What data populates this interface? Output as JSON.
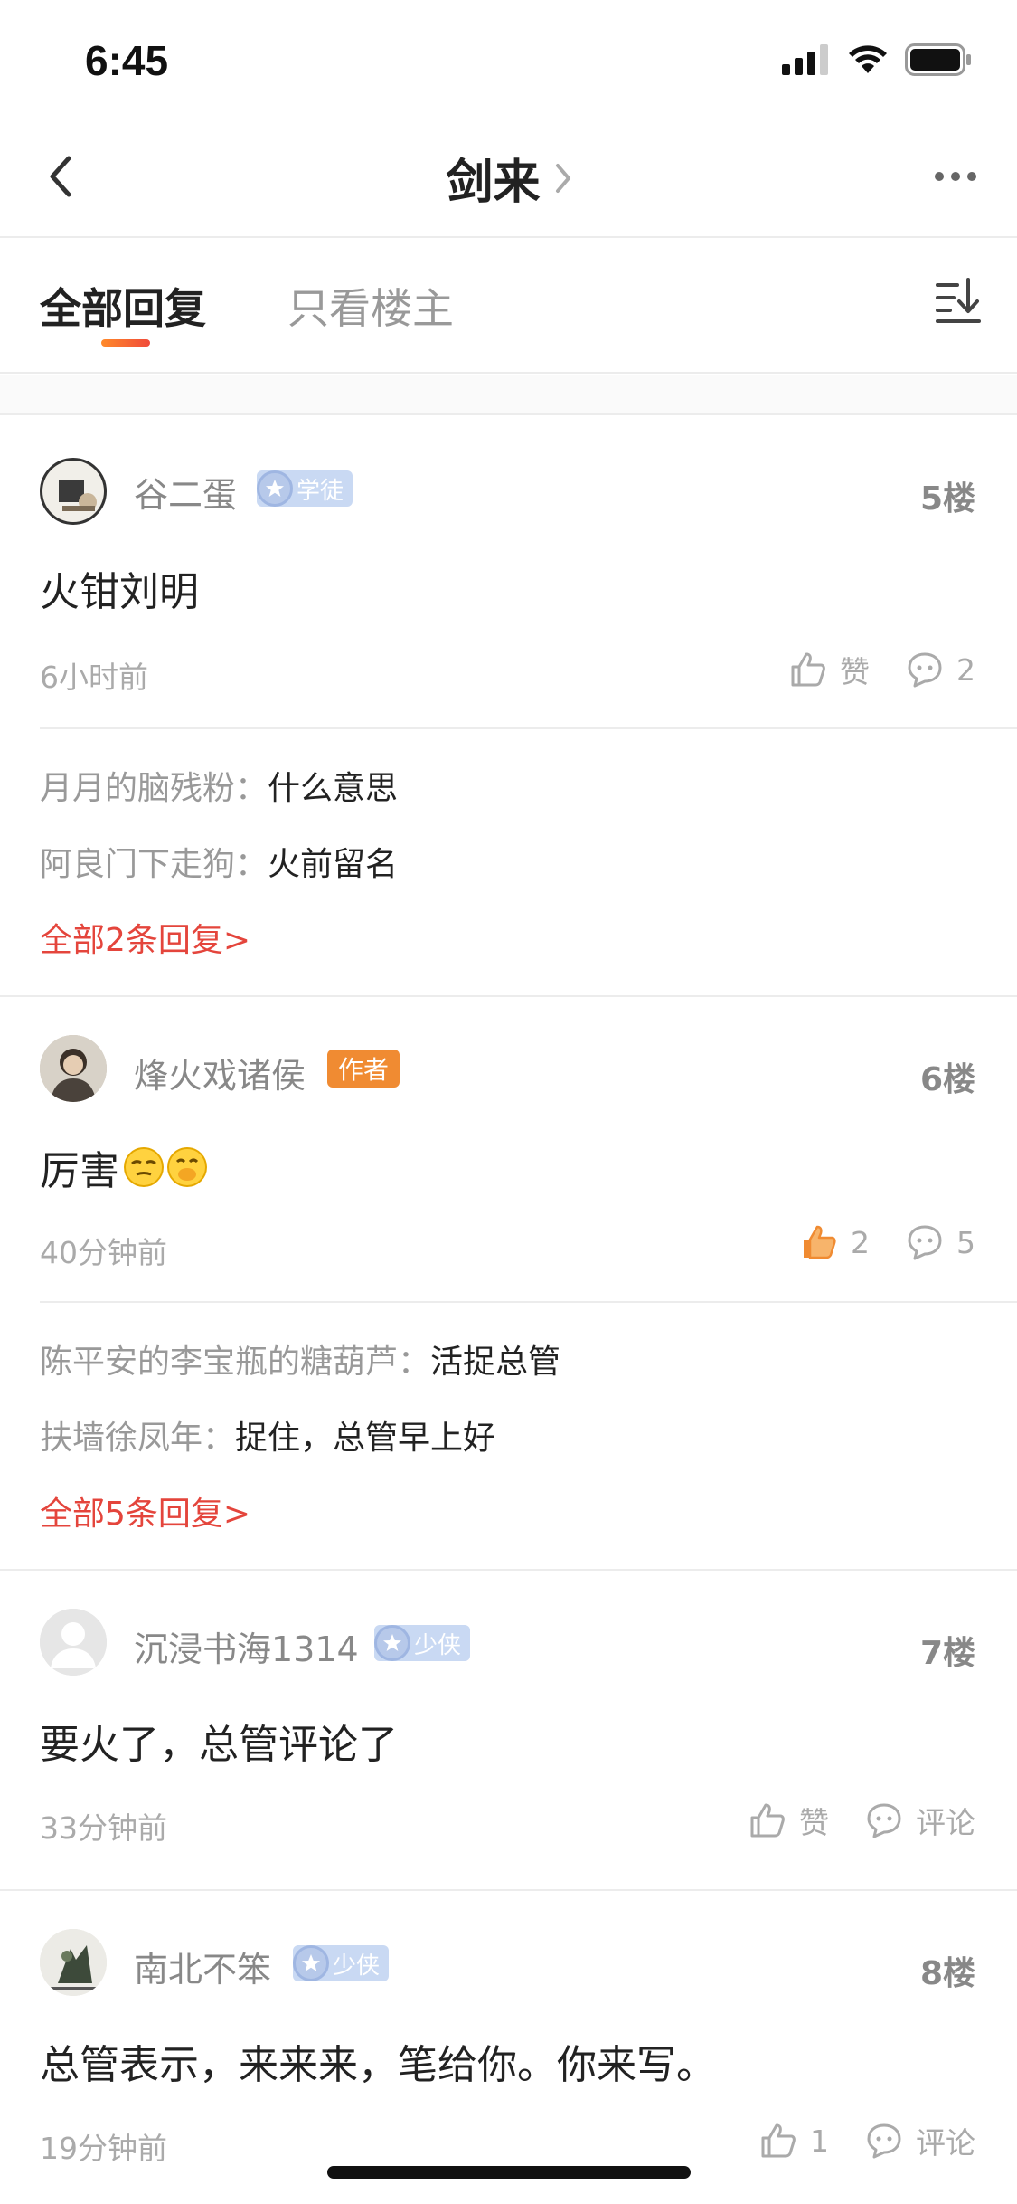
{
  "status": {
    "time": "6:45"
  },
  "nav": {
    "title": "剑来"
  },
  "tabs": {
    "all": "全部回复",
    "owner_only": "只看楼主"
  },
  "colors": {
    "accent_red": "#e4453c",
    "author_badge": "#f08b32",
    "liked_orange": "#f08b32"
  },
  "posts": [
    {
      "username": "谷二蛋",
      "badge": "学徒",
      "badge_type": "level",
      "floor": "5楼",
      "text": "火钳刘明",
      "time": "6小时前",
      "like_label": "赞",
      "comment_label": "2",
      "replies": [
        {
          "user": "月月的脑残粉：",
          "text": "什么意思"
        },
        {
          "user": "阿良门下走狗：",
          "text": "火前留名"
        }
      ],
      "more_replies": "全部2条回复>"
    },
    {
      "username": "烽火戏诸侯",
      "badge": "作者",
      "badge_type": "author",
      "floor": "6楼",
      "text": "厉害",
      "emoji": [
        "sly-face-emoji",
        "mouth-cover-emoji"
      ],
      "time": "40分钟前",
      "like_label": "2",
      "comment_label": "5",
      "liked": true,
      "replies": [
        {
          "user": "陈平安的李宝瓶的糖葫芦：",
          "text": "活捉总管"
        },
        {
          "user": "扶墙徐凤年：",
          "text": "捉住，总管早上好"
        }
      ],
      "more_replies": "全部5条回复>"
    },
    {
      "username": "沉浸书海1314",
      "badge": "少侠",
      "badge_type": "level",
      "floor": "7楼",
      "text": "要火了，总管评论了",
      "time": "33分钟前",
      "like_label": "赞",
      "comment_label": "评论"
    },
    {
      "username": "南北不笨",
      "badge": "少侠",
      "badge_type": "level",
      "floor": "8楼",
      "text": "总管表示，来来来，笔给你。你来写。",
      "time": "19分钟前",
      "like_label": "1",
      "comment_label": "评论"
    }
  ]
}
